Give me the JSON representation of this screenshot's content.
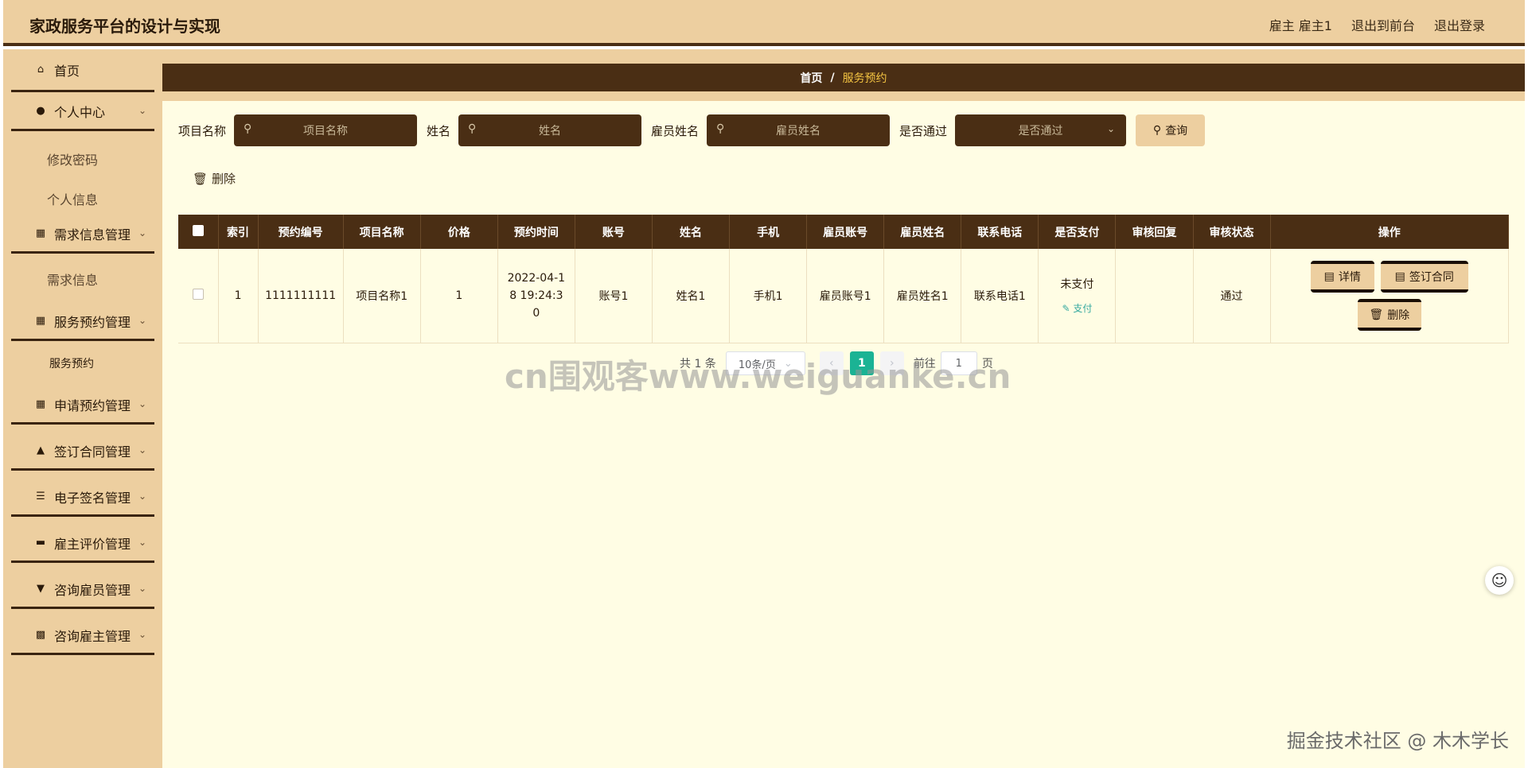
{
  "header": {
    "title": "家政服务平台的设计与实现",
    "user": "雇主 雇主1",
    "to_front": "退出到前台",
    "logout": "退出登录"
  },
  "sidebar": {
    "home": "首页",
    "personal": "个人中心",
    "change_password": "修改密码",
    "personal_info": "个人信息",
    "demand_mgmt": "需求信息管理",
    "demand_info": "需求信息",
    "booking_mgmt": "服务预约管理",
    "booking": "服务预约",
    "apply_mgmt": "申请预约管理",
    "contract_mgmt": "签订合同管理",
    "esign_mgmt": "电子签名管理",
    "review_mgmt": "雇主评价管理",
    "consult_staff_mgmt": "咨询雇员管理",
    "consult_employer_mgmt": "咨询雇主管理"
  },
  "breadcrumb": {
    "home": "首页",
    "sep": "/",
    "current": "服务预约"
  },
  "search": {
    "project_label": "项目名称",
    "project_placeholder": "项目名称",
    "name_label": "姓名",
    "name_placeholder": "姓名",
    "staff_label": "雇员姓名",
    "staff_placeholder": "雇员姓名",
    "pass_label": "是否通过",
    "pass_placeholder": "是否通过",
    "query": "查询"
  },
  "toolbar": {
    "delete": "删除"
  },
  "table": {
    "headers": [
      "索引",
      "预约编号",
      "项目名称",
      "价格",
      "预约时间",
      "账号",
      "姓名",
      "手机",
      "雇员账号",
      "雇员姓名",
      "联系电话",
      "是否支付",
      "审核回复",
      "审核状态",
      "操作"
    ],
    "row": {
      "index": "1",
      "booking_no": "1111111111",
      "project": "项目名称1",
      "price": "1",
      "time": "2022-04-18 19:24:30",
      "account": "账号1",
      "name": "姓名1",
      "phone": "手机1",
      "staff_account": "雇员账号1",
      "staff_name": "雇员姓名1",
      "contact": "联系电话1",
      "paid": "未支付",
      "pay_action": "支付",
      "reply": "",
      "status": "通过",
      "detail": "详情",
      "sign": "签订合同",
      "delete": "删除"
    }
  },
  "pagination": {
    "total": "共 1 条",
    "page_size": "10条/页",
    "current": "1",
    "goto": "前往",
    "goto_value": "1",
    "page_unit": "页"
  },
  "watermarks": {
    "center": "cn围观客www.weiguanke.cn",
    "corner": "掘金技术社区 @ 木木学长"
  },
  "colors": {
    "primary_dark": "#4a2e14",
    "tan": "#edcfa0",
    "content_bg": "#fffde4",
    "pager_active": "#1bb394",
    "breadcrumb_current": "#f5c542"
  }
}
